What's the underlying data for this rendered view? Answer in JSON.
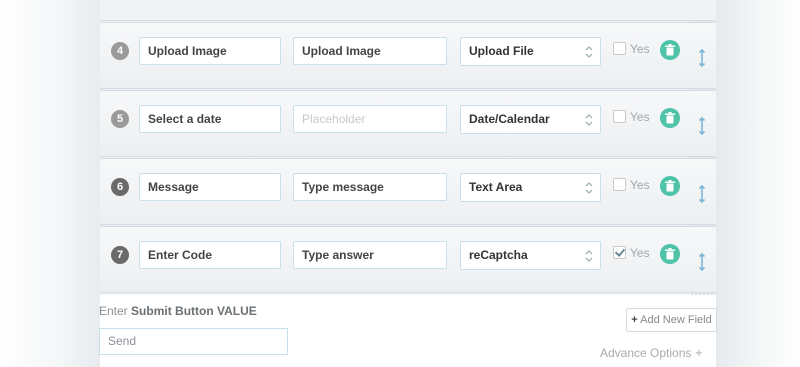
{
  "rows": [
    {
      "num": "4",
      "label": "Upload Image",
      "placeholder": "Upload Image",
      "placeholder_empty": false,
      "type": "Upload File",
      "required": false,
      "required_label": "Yes"
    },
    {
      "num": "5",
      "label": "Select a date",
      "placeholder": "Placeholder",
      "placeholder_empty": true,
      "type": "Date/Calendar",
      "required": false,
      "required_label": "Yes"
    },
    {
      "num": "6",
      "label": "Message",
      "placeholder": "Type message",
      "placeholder_empty": false,
      "type": "Text Area",
      "required": false,
      "required_label": "Yes"
    },
    {
      "num": "7",
      "label": "Enter Code",
      "placeholder": "Type answer",
      "placeholder_empty": false,
      "type": "reCaptcha",
      "required": true,
      "required_label": "Yes"
    }
  ],
  "submit": {
    "label_prefix": "Enter",
    "label_bold": "Submit Button VALUE",
    "value": "Send"
  },
  "add_field_button": {
    "plus": "+",
    "label": "Add New Field"
  },
  "advance_options": {
    "label": "Advance Options",
    "plus": "+"
  },
  "colors": {
    "accent": "#4ec3a8",
    "input_border": "#c7e0ea",
    "drag_handle": "#7fb6d8"
  }
}
